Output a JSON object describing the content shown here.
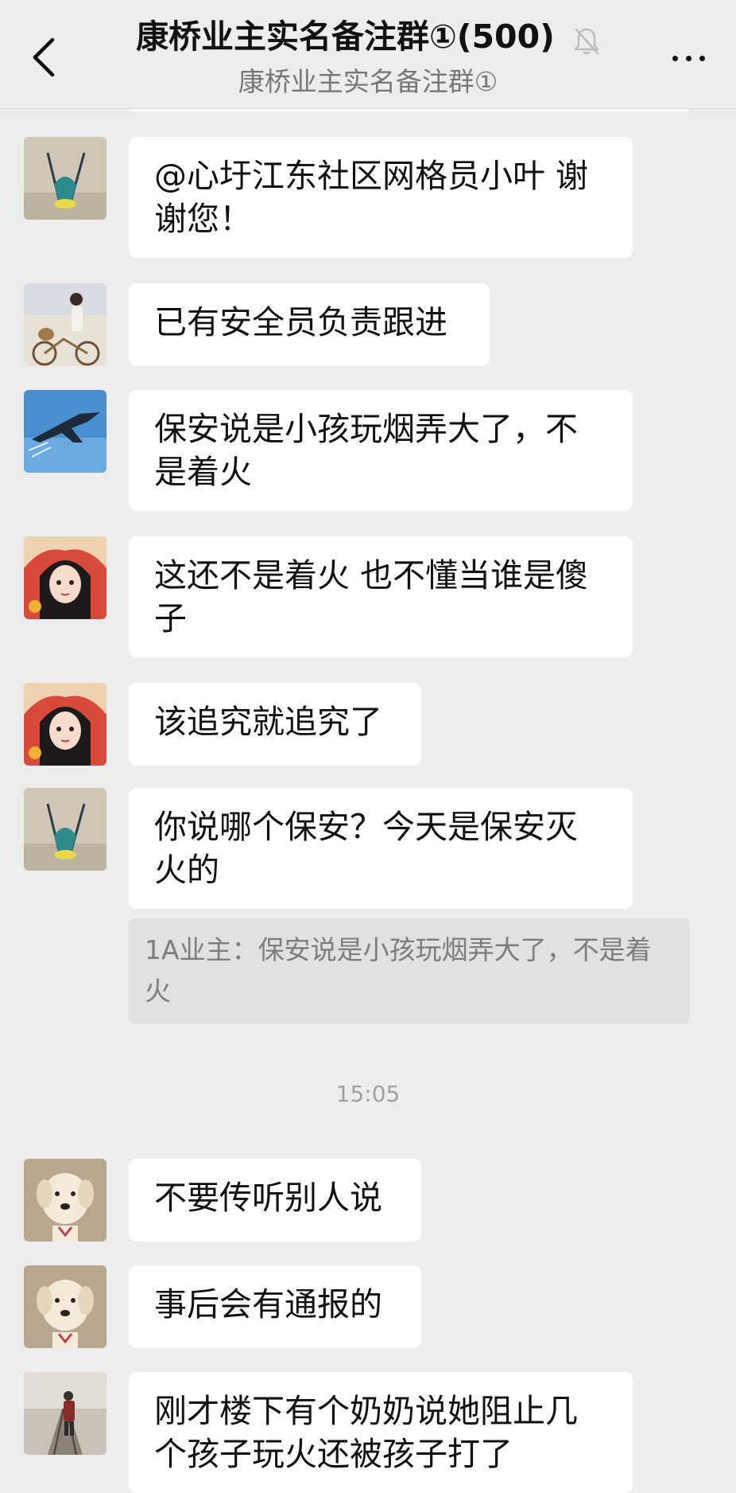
{
  "header": {
    "title": "康桥业主实名备注群①(500)",
    "subtitle": "康桥业主实名备注群①"
  },
  "messages": [
    {
      "avatar": "plant-avatar",
      "text": "@心圩江东社区网格员小叶  谢谢您！"
    },
    {
      "avatar": "cyclist-avatar",
      "text": "已有安全员负责跟进"
    },
    {
      "avatar": "jet-avatar",
      "text": "保安说是小孩玩烟弄大了，不是着火"
    },
    {
      "avatar": "girl-avatar",
      "text": "这还不是着火   也不懂当谁是傻子"
    },
    {
      "avatar": "girl-avatar",
      "text": "该追究就追究了"
    },
    {
      "avatar": "plant-avatar",
      "text": "你说哪个保安？今天是保安灭火的"
    },
    {
      "avatar": "dog-avatar",
      "text": "不要传听别人说"
    },
    {
      "avatar": "dog-avatar",
      "text": "事后会有通报的"
    },
    {
      "avatar": "railway-avatar",
      "text": "刚才楼下有个奶奶说她阻止几个孩子玩火还被孩子打了"
    }
  ],
  "quote": "1A业主：保安说是小孩玩烟弄大了，不是着火",
  "timestamp": "15:05",
  "colors": {
    "background": "#ededed",
    "bubble": "#ffffff",
    "quote_bg": "#e1e1e1",
    "quote_text": "#7d7d7d",
    "subtitle": "#777777"
  }
}
